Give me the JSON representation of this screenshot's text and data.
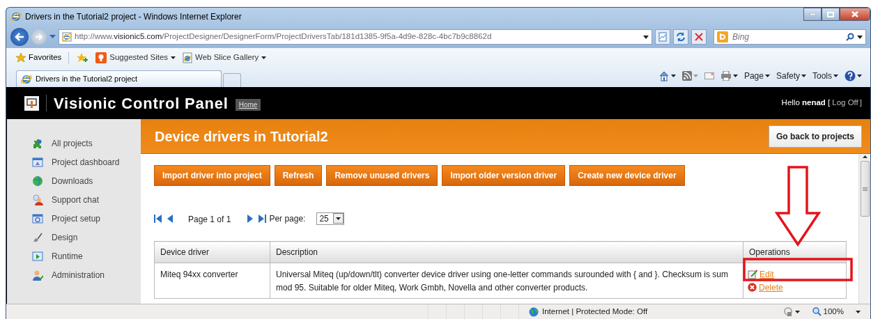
{
  "window": {
    "title": "Drivers in the Tutorial2 project - Windows Internet Explorer"
  },
  "address_bar": {
    "url": "http://www.**visionic5.com**/ProjectDesigner/DesignerForm/ProjectDriversTab/181d1385-9f5a-4d9e-828c-4bc7b9c8862d"
  },
  "search": {
    "placeholder": "Bing"
  },
  "favorites_bar": {
    "items": [
      {
        "label": "Favorites",
        "kind": "favorites",
        "dropdown": false
      },
      {
        "label": "Suggested Sites",
        "kind": "suggested",
        "dropdown": true
      },
      {
        "label": "Web Slice Gallery",
        "kind": "webslice",
        "dropdown": true
      }
    ]
  },
  "tabs": [
    {
      "label": "Drivers in the Tutorial2 project",
      "selected": true
    }
  ],
  "command_bar": {
    "menus": [
      "Page",
      "Safety",
      "Tools"
    ]
  },
  "app": {
    "title": "Visionic Control Panel",
    "home": "Home",
    "greeting": "Hello **nenad** [",
    "logoff": "Log Off",
    "closing": "]"
  },
  "sidebar": {
    "items": [
      {
        "label": "All projects"
      },
      {
        "label": "Project dashboard"
      },
      {
        "label": "Downloads"
      },
      {
        "label": "Support chat"
      },
      {
        "label": "Project setup"
      },
      {
        "label": "Design"
      },
      {
        "label": "Runtime"
      },
      {
        "label": "Administration"
      }
    ]
  },
  "page": {
    "title": "Device drivers in Tutorial2",
    "back_button": "Go back to projects"
  },
  "actions": [
    "Import driver into project",
    "Refresh",
    "Remove unused drivers",
    "Import older version driver",
    "Create new device driver"
  ],
  "pager": {
    "page_text": "Page 1 of 1",
    "per_page_label": "Per page:",
    "per_page": "25"
  },
  "table": {
    "columns": [
      "Device driver",
      "Description",
      "Operations"
    ],
    "rows": [
      {
        "driver": "Miteq 94xx converter",
        "description": "Universal Miteq (up/down/tlt) converter device driver using one-letter commands surounded with { and }. Checksum is sum mod 95. Suitable for older Miteq, Work Gmbh, Novella and other converter products.",
        "operations": [
          {
            "label": "Edit",
            "kind": "edit"
          },
          {
            "label": "Delete",
            "kind": "delete"
          }
        ]
      }
    ]
  },
  "status_bar": {
    "zone": "Internet | Protected Mode: Off",
    "zoom": "100%"
  }
}
